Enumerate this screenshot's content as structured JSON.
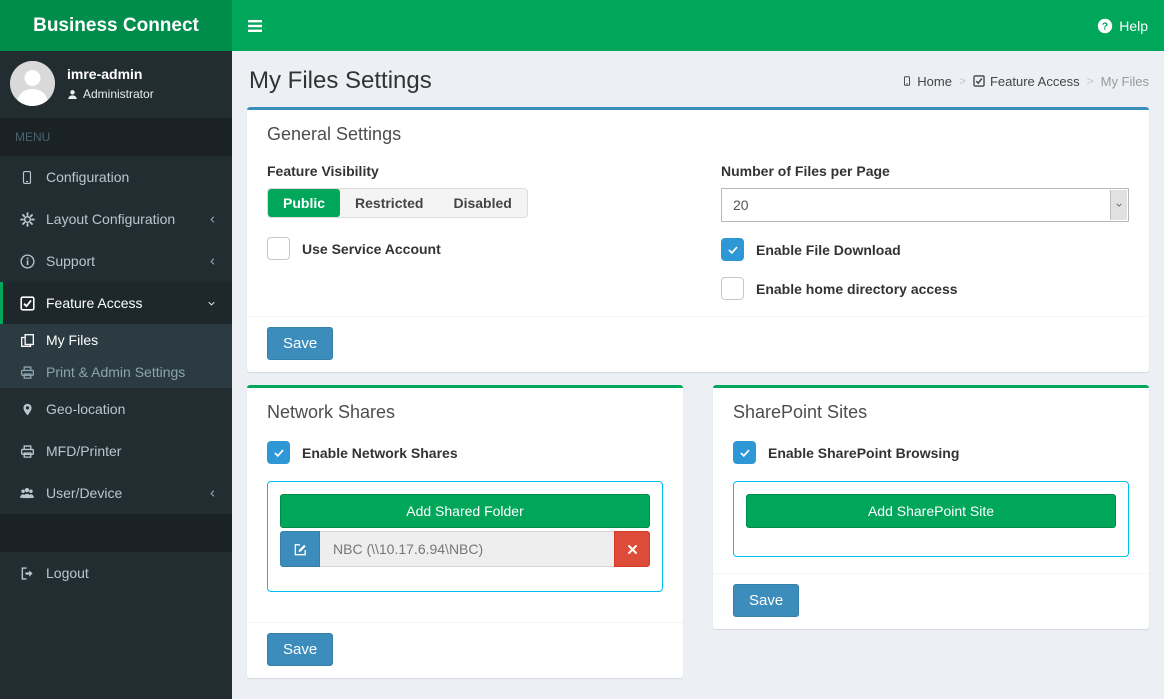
{
  "navbar": {
    "brand": "Business Connect",
    "help_label": "Help"
  },
  "sidebar": {
    "user": {
      "name": "imre-admin",
      "role": "Administrator"
    },
    "menu_header": "MENU",
    "items": [
      {
        "label": "Configuration"
      },
      {
        "label": "Layout Configuration"
      },
      {
        "label": "Support"
      },
      {
        "label": "Feature Access"
      },
      {
        "label": "My Files"
      },
      {
        "label": "Print & Admin Settings"
      },
      {
        "label": "Geo-location"
      },
      {
        "label": "MFD/Printer"
      },
      {
        "label": "User/Device"
      },
      {
        "label": "Logout"
      }
    ]
  },
  "header": {
    "title": "My Files Settings",
    "breadcrumb": {
      "home": "Home",
      "section": "Feature Access",
      "current": "My Files"
    }
  },
  "general": {
    "title": "General Settings",
    "feature_visibility_label": "Feature Visibility",
    "visibility_options": [
      "Public",
      "Restricted",
      "Disabled"
    ],
    "visibility_selected": "Public",
    "use_service_account_label": "Use Service Account",
    "use_service_account_checked": false,
    "files_per_page_label": "Number of Files per Page",
    "files_per_page_value": "20",
    "enable_file_download_label": "Enable File Download",
    "enable_file_download_checked": true,
    "enable_home_dir_label": "Enable home directory access",
    "enable_home_dir_checked": false,
    "save_label": "Save"
  },
  "network_shares": {
    "title": "Network Shares",
    "enable_label": "Enable Network Shares",
    "enable_checked": true,
    "add_button_label": "Add Shared Folder",
    "shares": [
      {
        "name": "NBC (\\\\10.17.6.94\\NBC)"
      }
    ],
    "save_label": "Save"
  },
  "sharepoint": {
    "title": "SharePoint Sites",
    "enable_label": "Enable SharePoint Browsing",
    "enable_checked": true,
    "add_button_label": "Add SharePoint Site",
    "save_label": "Save"
  },
  "colors": {
    "brand_green": "#00a65a",
    "logo_green": "#008d4c",
    "primary_blue": "#3c8dbc",
    "checkbox_blue": "#2e97d6",
    "danger_red": "#dd4b39",
    "info_cyan": "#00c0ef",
    "sidebar_dark": "#222d32",
    "content_bg": "#ecf0f5"
  }
}
